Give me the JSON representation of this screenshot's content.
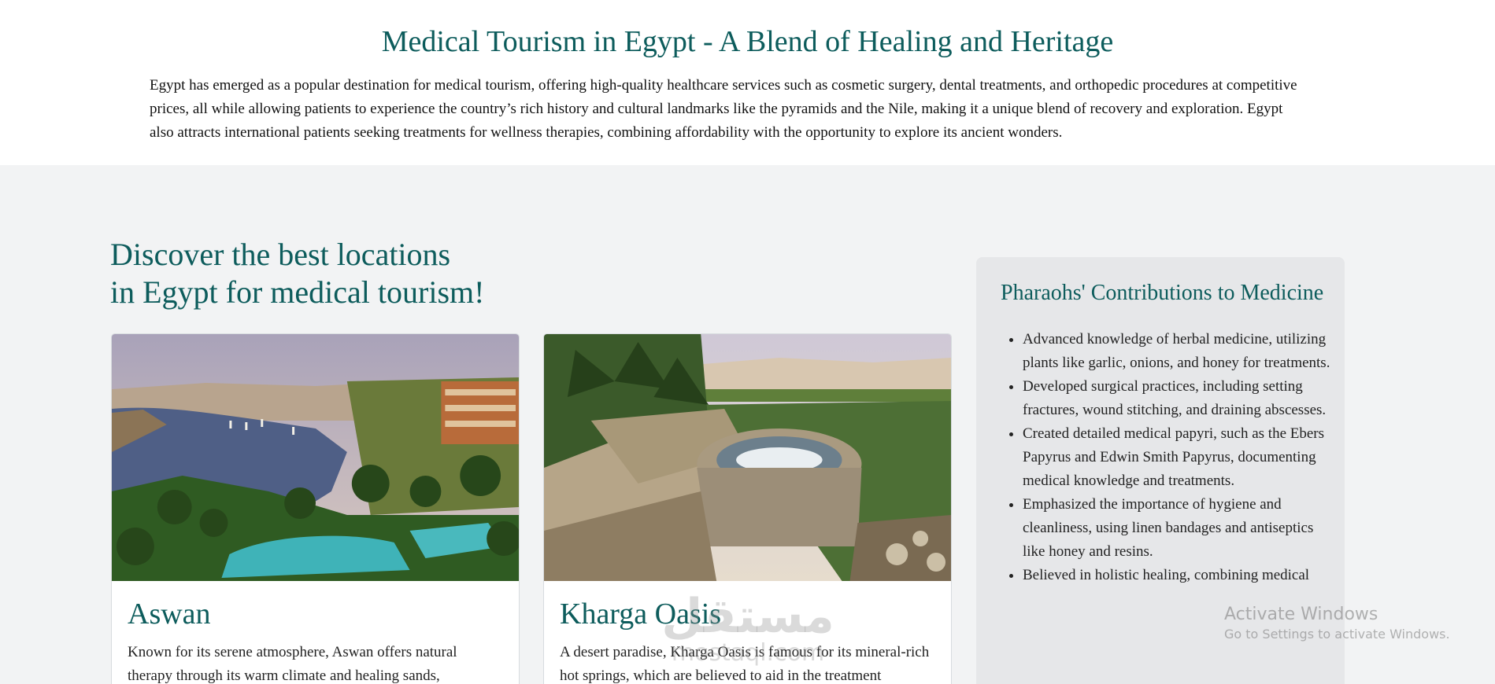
{
  "intro": {
    "title": "Medical Tourism in Egypt - A Blend of Healing and Heritage",
    "text": "Egypt has emerged as a popular destination for medical tourism, offering high-quality healthcare services such as cosmetic surgery, dental treatments, and orthopedic procedures at competitive prices, all while allowing patients to experience the country’s rich history and cultural landmarks like the pyramids and the Nile, making it a unique blend of recovery and exploration. Egypt also attracts international patients seeking treatments for wellness therapies, combining affordability with the opportunity to explore its ancient wonders."
  },
  "discover": {
    "title_line1": "Discover the best locations",
    "title_line2": "in Egypt for medical tourism!"
  },
  "cards": [
    {
      "title": "Aswan",
      "text": "Known for its serene atmosphere, Aswan offers natural therapy through its warm climate and healing sands,"
    },
    {
      "title": "Kharga Oasis",
      "text": "A desert paradise, Kharga Oasis is famous for its mineral-rich hot springs, which are believed to aid in the treatment"
    }
  ],
  "sidebar": {
    "title": "Pharaohs' Contributions to Medicine",
    "items": [
      "Advanced knowledge of herbal medicine, utilizing plants like garlic, onions, and honey for treatments.",
      "Developed surgical practices, including setting fractures, wound stitching, and draining abscesses.",
      "Created detailed medical papyri, such as the Ebers Papyrus and Edwin Smith Papyrus, documenting medical knowledge and treatments.",
      "Emphasized the importance of hygiene and cleanliness, using linen bandages and antiseptics like honey and resins.",
      "Believed in holistic healing, combining medical"
    ]
  },
  "watermark": {
    "arabic": "مستقل",
    "latin": "mostaql.com"
  },
  "os_notice": {
    "line1": "Activate Windows",
    "line2": "Go to Settings to activate Windows."
  }
}
